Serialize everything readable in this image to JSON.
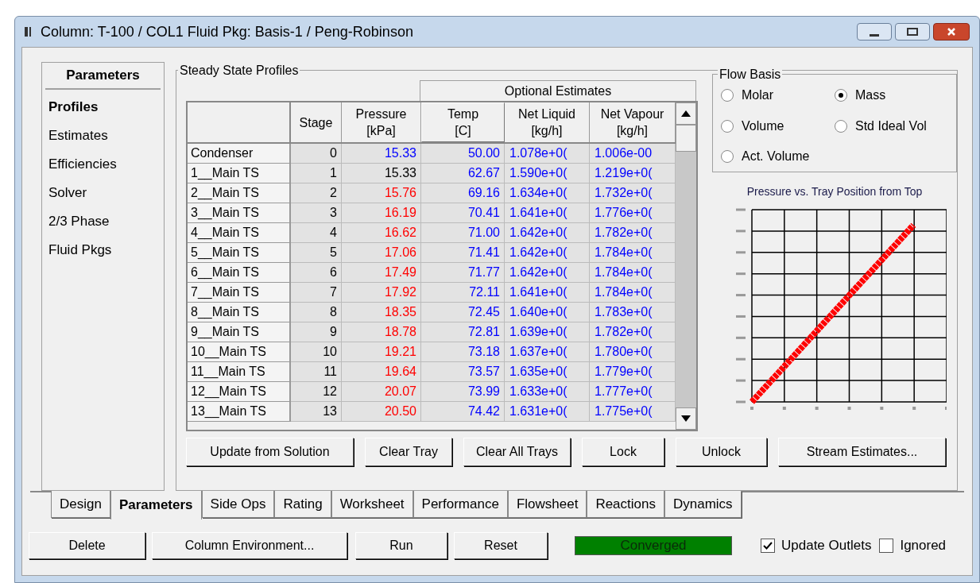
{
  "window": {
    "title": "Column: T-100 / COL1  Fluid Pkg: Basis-1 / Peng-Robinson"
  },
  "sidebar": {
    "title": "Parameters",
    "items": [
      {
        "label": "Profiles",
        "selected": true
      },
      {
        "label": "Estimates",
        "selected": false
      },
      {
        "label": "Efficiencies",
        "selected": false
      },
      {
        "label": "Solver",
        "selected": false
      },
      {
        "label": "2/3 Phase",
        "selected": false
      },
      {
        "label": "Fluid Pkgs",
        "selected": false
      }
    ]
  },
  "profiles": {
    "title": "Steady State Profiles",
    "group_header": "Optional Estimates",
    "columns": [
      {
        "label": "Stage"
      },
      {
        "label": "Pressure",
        "unit": "[kPa]"
      },
      {
        "label": "Temp",
        "unit": "[C]"
      },
      {
        "label": "Net Liquid",
        "unit": "[kg/h]"
      },
      {
        "label": "Net Vapour",
        "unit": "[kg/h]"
      }
    ],
    "rows": [
      {
        "name": "Condenser",
        "stage": "0",
        "pressure": "15.33",
        "color": "#0000ff",
        "temp": "50.00",
        "net_liquid": "1.078e+0(",
        "net_vapour": "1.006e-00"
      },
      {
        "name": "1__Main TS",
        "stage": "1",
        "pressure": "15.33",
        "color": "#000000",
        "temp": "62.67",
        "net_liquid": "1.590e+0(",
        "net_vapour": "1.219e+0("
      },
      {
        "name": "2__Main TS",
        "stage": "2",
        "pressure": "15.76",
        "color": "#ff0000",
        "temp": "69.16",
        "net_liquid": "1.634e+0(",
        "net_vapour": "1.732e+0("
      },
      {
        "name": "3__Main TS",
        "stage": "3",
        "pressure": "16.19",
        "color": "#ff0000",
        "temp": "70.41",
        "net_liquid": "1.641e+0(",
        "net_vapour": "1.776e+0("
      },
      {
        "name": "4__Main TS",
        "stage": "4",
        "pressure": "16.62",
        "color": "#ff0000",
        "temp": "71.00",
        "net_liquid": "1.642e+0(",
        "net_vapour": "1.782e+0("
      },
      {
        "name": "5__Main TS",
        "stage": "5",
        "pressure": "17.06",
        "color": "#ff0000",
        "temp": "71.41",
        "net_liquid": "1.642e+0(",
        "net_vapour": "1.784e+0("
      },
      {
        "name": "6__Main TS",
        "stage": "6",
        "pressure": "17.49",
        "color": "#ff0000",
        "temp": "71.77",
        "net_liquid": "1.642e+0(",
        "net_vapour": "1.784e+0("
      },
      {
        "name": "7__Main TS",
        "stage": "7",
        "pressure": "17.92",
        "color": "#ff0000",
        "temp": "72.11",
        "net_liquid": "1.641e+0(",
        "net_vapour": "1.784e+0("
      },
      {
        "name": "8__Main TS",
        "stage": "8",
        "pressure": "18.35",
        "color": "#ff0000",
        "temp": "72.45",
        "net_liquid": "1.640e+0(",
        "net_vapour": "1.783e+0("
      },
      {
        "name": "9__Main TS",
        "stage": "9",
        "pressure": "18.78",
        "color": "#ff0000",
        "temp": "72.81",
        "net_liquid": "1.639e+0(",
        "net_vapour": "1.782e+0("
      },
      {
        "name": "10__Main TS",
        "stage": "10",
        "pressure": "19.21",
        "color": "#ff0000",
        "temp": "73.18",
        "net_liquid": "1.637e+0(",
        "net_vapour": "1.780e+0("
      },
      {
        "name": "11__Main TS",
        "stage": "11",
        "pressure": "19.64",
        "color": "#ff0000",
        "temp": "73.57",
        "net_liquid": "1.635e+0(",
        "net_vapour": "1.779e+0("
      },
      {
        "name": "12__Main TS",
        "stage": "12",
        "pressure": "20.07",
        "color": "#ff0000",
        "temp": "73.99",
        "net_liquid": "1.633e+0(",
        "net_vapour": "1.777e+0("
      },
      {
        "name": "13__Main TS",
        "stage": "13",
        "pressure": "20.50",
        "color": "#ff0000",
        "temp": "74.42",
        "net_liquid": "1.631e+0(",
        "net_vapour": "1.775e+0("
      }
    ]
  },
  "profile_buttons": [
    "Update from Solution",
    "Clear Tray",
    "Clear All Trays",
    "Lock",
    "Unlock",
    "Stream Estimates..."
  ],
  "flow_basis": {
    "title": "Flow Basis",
    "options": [
      {
        "label": "Molar",
        "selected": false
      },
      {
        "label": "Mass",
        "selected": true
      },
      {
        "label": "Volume",
        "selected": false
      },
      {
        "label": "Std Ideal Vol",
        "selected": false
      },
      {
        "label": "Act. Volume",
        "selected": false
      }
    ]
  },
  "chart": {
    "title": "Pressure vs. Tray Position from Top"
  },
  "tabs": [
    {
      "label": "Design",
      "selected": false
    },
    {
      "label": "Parameters",
      "selected": true
    },
    {
      "label": "Side Ops",
      "selected": false
    },
    {
      "label": "Rating",
      "selected": false
    },
    {
      "label": "Worksheet",
      "selected": false
    },
    {
      "label": "Performance",
      "selected": false
    },
    {
      "label": "Flowsheet",
      "selected": false
    },
    {
      "label": "Reactions",
      "selected": false
    },
    {
      "label": "Dynamics",
      "selected": false
    }
  ],
  "actions": [
    "Delete",
    "Column Environment...",
    "Run",
    "Reset"
  ],
  "status": {
    "label": "Converged"
  },
  "checkboxes": [
    {
      "label": "Update Outlets",
      "checked": true
    },
    {
      "label": "Ignored",
      "checked": false
    }
  ]
}
